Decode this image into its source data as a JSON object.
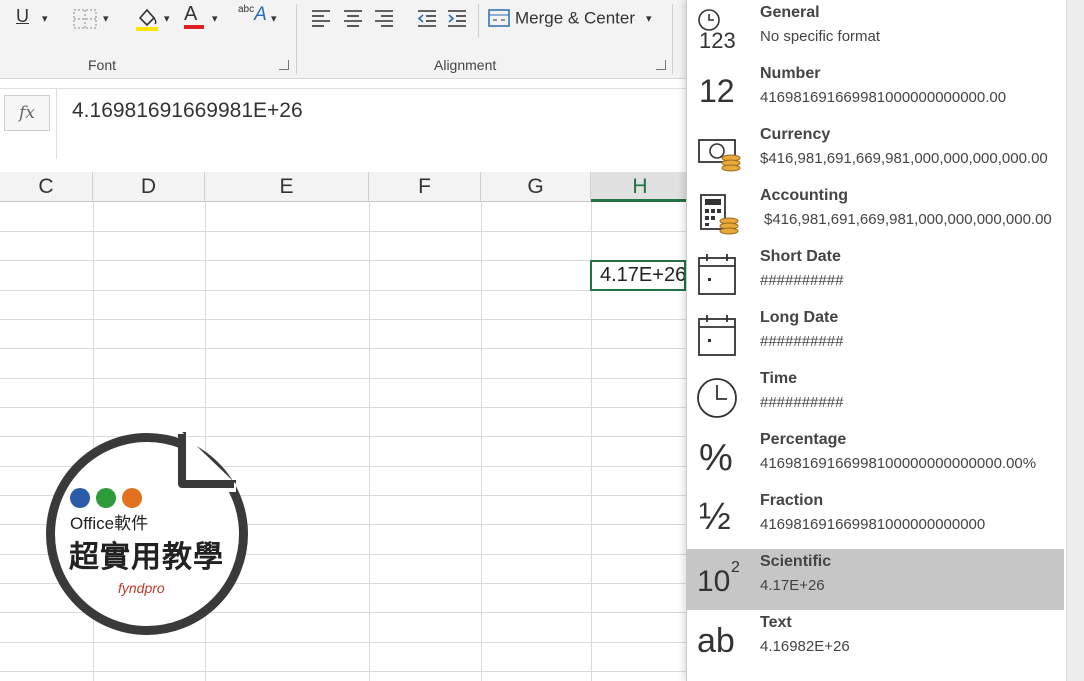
{
  "ribbon": {
    "underline": "U",
    "font_color_letter": "A",
    "orientation_small": "abc",
    "orientation_big": "A",
    "merge_center": "Merge & Center",
    "font_group": "Font",
    "alignment_group": "Alignment"
  },
  "formula_bar": {
    "fx": "fx",
    "value": "4.16981691669981E+26"
  },
  "columns": [
    "C",
    "D",
    "E",
    "F",
    "G",
    "H"
  ],
  "active_cell": {
    "display": "4.17E+26"
  },
  "format_menu": {
    "items": [
      {
        "name": "General",
        "sample": "No specific format",
        "icon": "clock-123-icon",
        "icon_text": "123"
      },
      {
        "name": "Number",
        "sample": "416981691669981000000000000.00",
        "icon": "number-12-icon",
        "icon_text": "12"
      },
      {
        "name": "Currency",
        "sample": "$416,981,691,669,981,000,000,000,000.00",
        "icon": "currency-icon"
      },
      {
        "name": "Accounting",
        "sample": "$416,981,691,669,981,000,000,000,000.00",
        "icon": "accounting-calculator-icon"
      },
      {
        "name": "Short Date",
        "sample": "##########",
        "icon": "calendar-icon"
      },
      {
        "name": "Long Date",
        "sample": "##########",
        "icon": "calendar-icon"
      },
      {
        "name": "Time",
        "sample": "##########",
        "icon": "clock-icon"
      },
      {
        "name": "Percentage",
        "sample": "41698169166998100000000000000.00%",
        "icon": "percent-icon",
        "icon_text": "%"
      },
      {
        "name": "Fraction",
        "sample": "416981691669981000000000000",
        "icon": "fraction-icon",
        "icon_text": "½"
      },
      {
        "name": "Scientific",
        "sample": "4.17E+26",
        "icon": "scientific-icon",
        "icon_text": "10",
        "icon_sup": "2"
      },
      {
        "name": "Text",
        "sample": "4.16982E+26",
        "icon": "text-ab-icon",
        "icon_text": "ab"
      }
    ],
    "selected_index": 9
  },
  "logo": {
    "line1": "Office軟件",
    "line2": "超實用教學",
    "brand": "fyndpro",
    "dot_colors": [
      "#2a5caa",
      "#2e9b3a",
      "#e2711d"
    ]
  }
}
